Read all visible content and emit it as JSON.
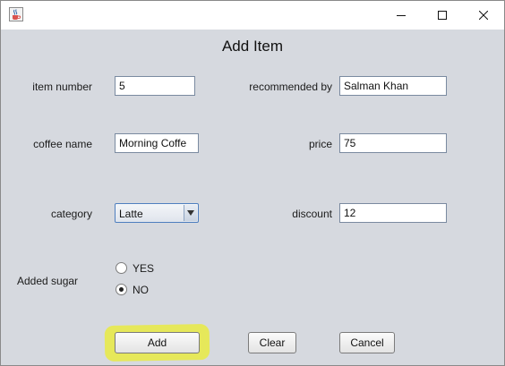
{
  "window": {
    "title": "",
    "icons": {
      "app": "java-cup-icon",
      "minimize": "minimize-icon",
      "maximize": "maximize-icon",
      "close": "close-icon"
    }
  },
  "dialog": {
    "title": "Add Item"
  },
  "form": {
    "item_number": {
      "label": "item number",
      "value": "5"
    },
    "recommended_by": {
      "label": "recommended by",
      "value": "Salman Khan"
    },
    "coffee_name": {
      "label": "coffee name",
      "value": "Morning Coffe"
    },
    "price": {
      "label": "price",
      "value": "75"
    },
    "category": {
      "label": "category",
      "selected": "Latte"
    },
    "discount": {
      "label": "discount",
      "value": "12"
    },
    "added_sugar": {
      "label": "Added sugar",
      "options": [
        {
          "label": "YES",
          "checked": false
        },
        {
          "label": "NO",
          "checked": true
        }
      ]
    }
  },
  "buttons": {
    "add": "Add",
    "clear": "Clear",
    "cancel": "Cancel"
  },
  "colors": {
    "window_bg": "#d6d9df",
    "highlight": "#e6e85a"
  }
}
